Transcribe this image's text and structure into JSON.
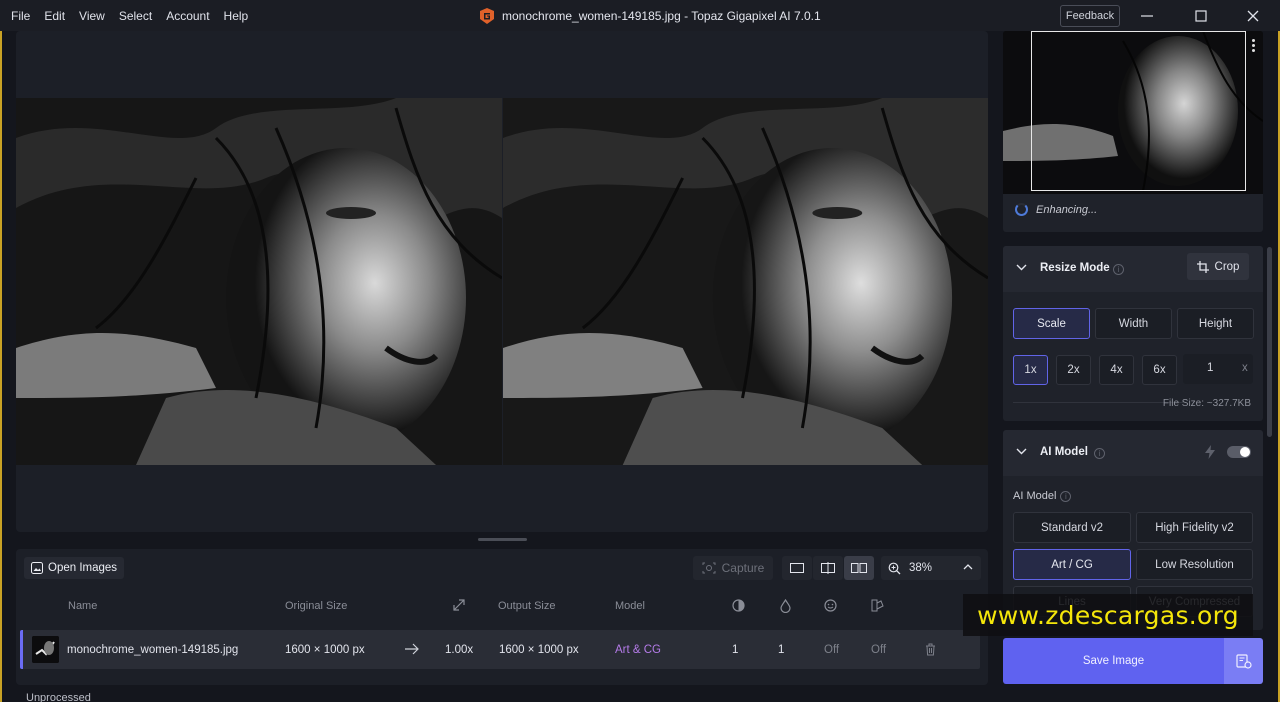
{
  "window": {
    "title": "monochrome_women-149185.jpg - Topaz Gigapixel AI 7.0.1",
    "feedback_label": "Feedback"
  },
  "menu": [
    "File",
    "Edit",
    "View",
    "Select",
    "Account",
    "Help"
  ],
  "toolbar": {
    "open_images_label": "Open Images",
    "capture_label": "Capture",
    "zoom_value": "38%"
  },
  "file_list": {
    "columns": [
      "Name",
      "Original Size",
      "Output Size",
      "Model"
    ],
    "row": {
      "name": "monochrome_women-149185.jpg",
      "original_size": "1600 × 1000 px",
      "scale": "1.00x",
      "output_size": "1600 × 1000 px",
      "model": "Art & CG",
      "val1": "1",
      "val2": "1",
      "face": "Off",
      "other": "Off"
    },
    "status": "Unprocessed"
  },
  "preview": {
    "status": "Enhancing..."
  },
  "resize_mode": {
    "title": "Resize Mode",
    "crop_label": "Crop",
    "modes": [
      "Scale",
      "Width",
      "Height"
    ],
    "selected_mode": "Scale",
    "scales": [
      "1x",
      "2x",
      "4x",
      "6x"
    ],
    "selected_scale": "1x",
    "custom_scale": "1",
    "custom_suffix": "x",
    "file_size": "File Size: ~327.7KB"
  },
  "ai_model": {
    "title": "AI Model",
    "label": "AI Model",
    "models": [
      "Standard v2",
      "High Fidelity v2",
      "Art / CG",
      "Low Resolution",
      "Lines",
      "Very Compressed"
    ],
    "selected": "Art / CG",
    "toggle_on": false
  },
  "save": {
    "label": "Save Image"
  },
  "watermark": "www.zdescargas.org",
  "colors": {
    "accent": "#5f62f0",
    "model_text": "#b47be8",
    "selected_border": "#6164e8"
  }
}
